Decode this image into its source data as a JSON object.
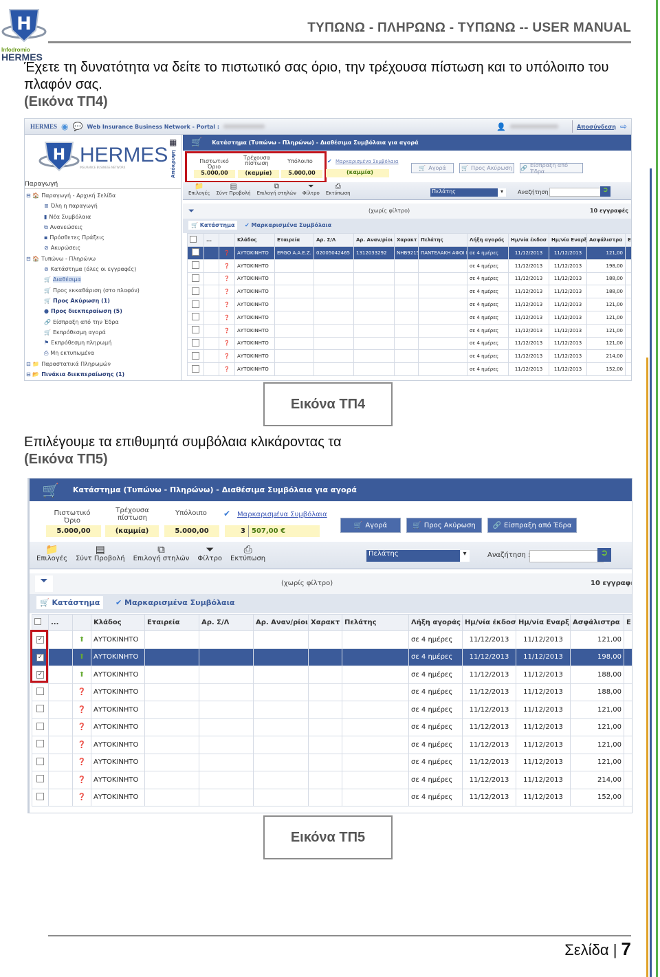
{
  "page": {
    "logo_brand": "HERMES",
    "logo_sub": "Infodromio",
    "header_title": "ΤΥΠΩΝΩ - ΠΛΗΡΩΝΩ - ΤΥΠΩΝΩ -- USER MANUAL",
    "para1": "Έχετε τη δυνατότητα να δείτε το πιστωτικό σας όριο, την τρέχουσα πίστωση και το υπόλοιπο του πλαφόν σας.",
    "para1_ref": "(Εικόνα ΤΠ4)",
    "caption1": "Εικόνα ΤΠ4",
    "para2": "Επιλέγουμε τα επιθυμητά συμβόλαια κλικάροντας τα",
    "para2_ref": "(Εικόνα ΤΠ5)",
    "caption2": "Εικόνα ΤΠ5",
    "footer_label": "Σελίδα",
    "footer_sep": "|",
    "page_number": "7",
    "colors": {
      "accent_blue": "#3b5b9a",
      "green": "#58b04a",
      "orange": "#e0a22a",
      "highlight_red": "#c0141c"
    }
  },
  "app": {
    "topbar_brand": "HERMES",
    "topbar_title": "Web Insurance Business Network - Portal :",
    "logout": "Αποσύνδεση",
    "logo_text": "HERMES",
    "logo_tagline": "INSURANCE BUSINESS NETWORK",
    "hide_label": "Απόκρυψη",
    "sidebar_title": "Παραγωγή",
    "sidebar_items": [
      {
        "label": "Παραγωγή - Αρχική Σελίδα",
        "icon": "home-icon",
        "level": 0,
        "bold": false
      },
      {
        "label": "Όλη η παραγωγή",
        "icon": "stack-icon",
        "level": 1,
        "bold": false
      },
      {
        "label": "Νέα Συμβόλαια",
        "icon": "clipboard-icon",
        "level": 1,
        "bold": false
      },
      {
        "label": "Ανανεώσεις",
        "icon": "renew-icon",
        "level": 1,
        "bold": false
      },
      {
        "label": "Πρόσθετες Πράξεις",
        "icon": "add-doc-icon",
        "level": 1,
        "bold": false
      },
      {
        "label": "Ακυρώσεις",
        "icon": "cancel-icon",
        "level": 1,
        "bold": false
      },
      {
        "label": "Τυπώνω - Πληρώνω",
        "icon": "home-icon",
        "level": 0,
        "bold": false
      },
      {
        "label": "Κατάστημα (όλες οι εγγραφές)",
        "icon": "store-icon",
        "level": 1,
        "bold": false
      },
      {
        "label": "Διαθέσιμα",
        "icon": "cart-icon",
        "level": 1,
        "bold": false,
        "selected": true
      },
      {
        "label": "Προς εκκαθάριση (στο πλαφόν)",
        "icon": "cart-check-icon",
        "level": 1,
        "bold": false
      },
      {
        "label": "Προς Ακύρωση (1)",
        "icon": "cart-cancel-icon",
        "level": 1,
        "bold": true
      },
      {
        "label": "Προς διεκπεραίωση (5)",
        "icon": "bag-icon",
        "level": 1,
        "bold": true
      },
      {
        "label": "Είσπραξη από την Έδρα",
        "icon": "link-icon",
        "level": 1,
        "bold": false
      },
      {
        "label": "Εκπρόθεσμη αγορά",
        "icon": "cart-red-icon",
        "level": 1,
        "bold": false
      },
      {
        "label": "Εκπρόθεσμη πληρωμή",
        "icon": "flag-icon",
        "level": 1,
        "bold": false
      },
      {
        "label": "Μη εκτυπωμένα",
        "icon": "printer-icon",
        "level": 1,
        "bold": false
      },
      {
        "label": "Παραστατικά Πληρωμών",
        "icon": "folder-icon",
        "level": 0,
        "bold": false
      },
      {
        "label": "Πινάκια διεκπεραίωσης (1)",
        "icon": "folder-doc-icon",
        "level": 0,
        "bold": true
      }
    ],
    "panel_title": "Κατάστημα (Τυπώνω - Πληρώνω) - Διαθέσιμα Συμβόλαια για αγορά",
    "credit": {
      "limit_label": "Πιστωτικό Όριο",
      "current_label": "Τρέχουσα πίστωση",
      "balance_label": "Υπόλοιπο",
      "limit": "5.000,00",
      "current": "(καμμία)",
      "balance": "5.000,00"
    },
    "marked_link": "Μαρκαρισμένα Συμβόλαια",
    "marked_empty": "(καμμία)",
    "marked_count": "3",
    "marked_total": "507,00 €",
    "actions": [
      "Αγορά",
      "Προς Ακύρωση",
      "Είσπραξη από Έδρα"
    ],
    "toolbar": [
      "Επιλογές",
      "Σύντ Προβολή",
      "Επιλογή στηλών",
      "Φίλτρο",
      "Εκτύπωση"
    ],
    "search_field_select": "Πελάτης",
    "search_label": "Αναζήτηση :",
    "search_value": "",
    "filter_status": "(χωρίς φίλτρο)",
    "record_count": "10 εγγραφές",
    "tabs": [
      "Κατάστημα",
      "Μαρκαρισμένα Συμβόλαια"
    ],
    "columns": [
      "...",
      "",
      "Κλάδος",
      "Εταιρεία",
      "Αρ. Σ/Λ",
      "Αρ. Αναν/ρίοι",
      "Χαρακτ",
      "Πελάτης",
      "Λήξη αγοράς",
      "Ημ/νία έκδοσ",
      "Ημ/νία Εναρξ",
      "Ασφάλιστρα",
      "Ε"
    ],
    "first_row_visible": {
      "company": "ERGO A.A.E.Z.",
      "policy": "02005042465",
      "renewal": "1312033292",
      "plate": "NHB9215",
      "client": "ΠΑΝΤΕΛΑΚΗ ΑΦΟΙ Ι"
    },
    "rows": [
      {
        "branch": "ΑΥΤΟΚΙΝΗΤΟ",
        "expiry": "σε 4 ημέρες",
        "issue": "11/12/2013",
        "start": "11/12/2013",
        "premium": "121,00"
      },
      {
        "branch": "ΑΥΤΟΚΙΝΗΤΟ",
        "expiry": "σε 4 ημέρες",
        "issue": "11/12/2013",
        "start": "11/12/2013",
        "premium": "198,00"
      },
      {
        "branch": "ΑΥΤΟΚΙΝΗΤΟ",
        "expiry": "σε 4 ημέρες",
        "issue": "11/12/2013",
        "start": "11/12/2013",
        "premium": "188,00"
      },
      {
        "branch": "ΑΥΤΟΚΙΝΗΤΟ",
        "expiry": "σε 4 ημέρες",
        "issue": "11/12/2013",
        "start": "11/12/2013",
        "premium": "188,00"
      },
      {
        "branch": "ΑΥΤΟΚΙΝΗΤΟ",
        "expiry": "σε 4 ημέρες",
        "issue": "11/12/2013",
        "start": "11/12/2013",
        "premium": "121,00"
      },
      {
        "branch": "ΑΥΤΟΚΙΝΗΤΟ",
        "expiry": "σε 4 ημέρες",
        "issue": "11/12/2013",
        "start": "11/12/2013",
        "premium": "121,00"
      },
      {
        "branch": "ΑΥΤΟΚΙΝΗΤΟ",
        "expiry": "σε 4 ημέρες",
        "issue": "11/12/2013",
        "start": "11/12/2013",
        "premium": "121,00"
      },
      {
        "branch": "ΑΥΤΟΚΙΝΗΤΟ",
        "expiry": "σε 4 ημέρες",
        "issue": "11/12/2013",
        "start": "11/12/2013",
        "premium": "121,00"
      },
      {
        "branch": "ΑΥΤΟΚΙΝΗΤΟ",
        "expiry": "σε 4 ημέρες",
        "issue": "11/12/2013",
        "start": "11/12/2013",
        "premium": "214,00"
      },
      {
        "branch": "ΑΥΤΟΚΙΝΗΤΟ",
        "expiry": "σε 4 ημέρες",
        "issue": "11/12/2013",
        "start": "11/12/2013",
        "premium": "152,00"
      }
    ],
    "shot1_selected_row": 0,
    "shot2_checked_rows": [
      0,
      1,
      2
    ],
    "shot2_selected_row": 1
  }
}
